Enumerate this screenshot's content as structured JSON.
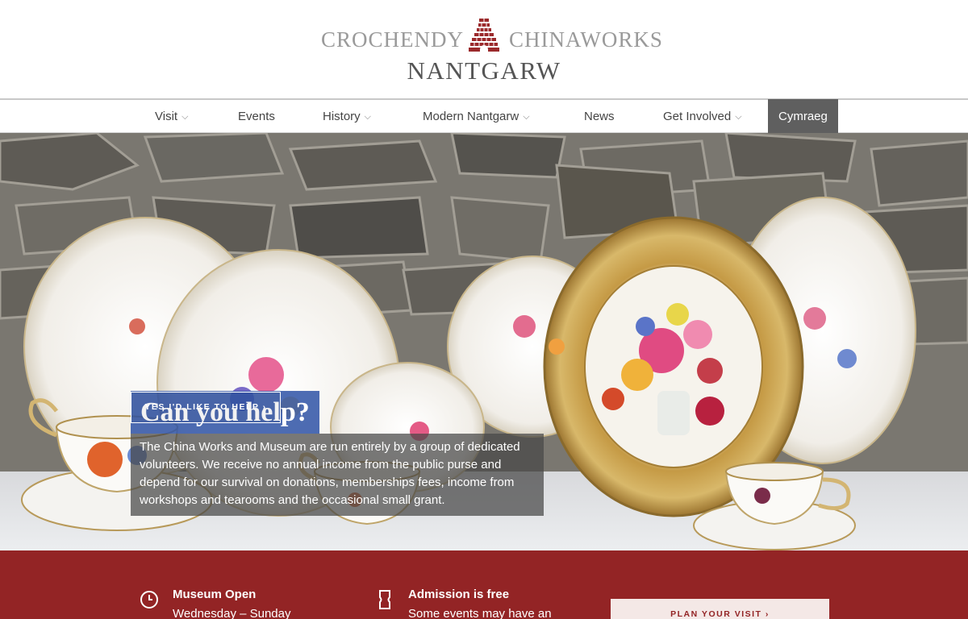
{
  "logo": {
    "line1_left": "CROCHENDY",
    "line1_right": "CHINAWORKS",
    "line2": "NANTGARW",
    "kiln_icon": "bottle-kiln-logo",
    "brand_color": "#9b2a2c"
  },
  "nav": {
    "items": [
      {
        "label": "Visit",
        "dropdown": true
      },
      {
        "label": "Events",
        "dropdown": false
      },
      {
        "label": "History",
        "dropdown": true
      },
      {
        "label": "Modern Nantgarw",
        "dropdown": true
      },
      {
        "label": "News",
        "dropdown": false
      },
      {
        "label": "Get Involved",
        "dropdown": true
      }
    ],
    "language": "Cymraeg",
    "chevron": "⌵"
  },
  "hero": {
    "title": "Can you help?",
    "body": "The China Works and Museum are run entirely by a group of dedicated volunteers. We receive no annual income from the public purse and depend for our survival on donations, memberships fees, income from workshops and tearooms and the occasional small grant.",
    "cta": "YES I'D LIKE TO HELP  ›",
    "title_bg": "#3458a8",
    "image": "porcelain-plates-and-teacups-against-stone-wall"
  },
  "info": {
    "band_color": "#932425",
    "hours": {
      "icon": "clock-icon",
      "heading": "Museum Open",
      "text": "Wednesday – Sunday"
    },
    "admission": {
      "icon": "ticket-icon",
      "heading": "Admission is free",
      "text": "Some events may have an"
    },
    "plan_button": "PLAN YOUR VISIT  ›"
  }
}
